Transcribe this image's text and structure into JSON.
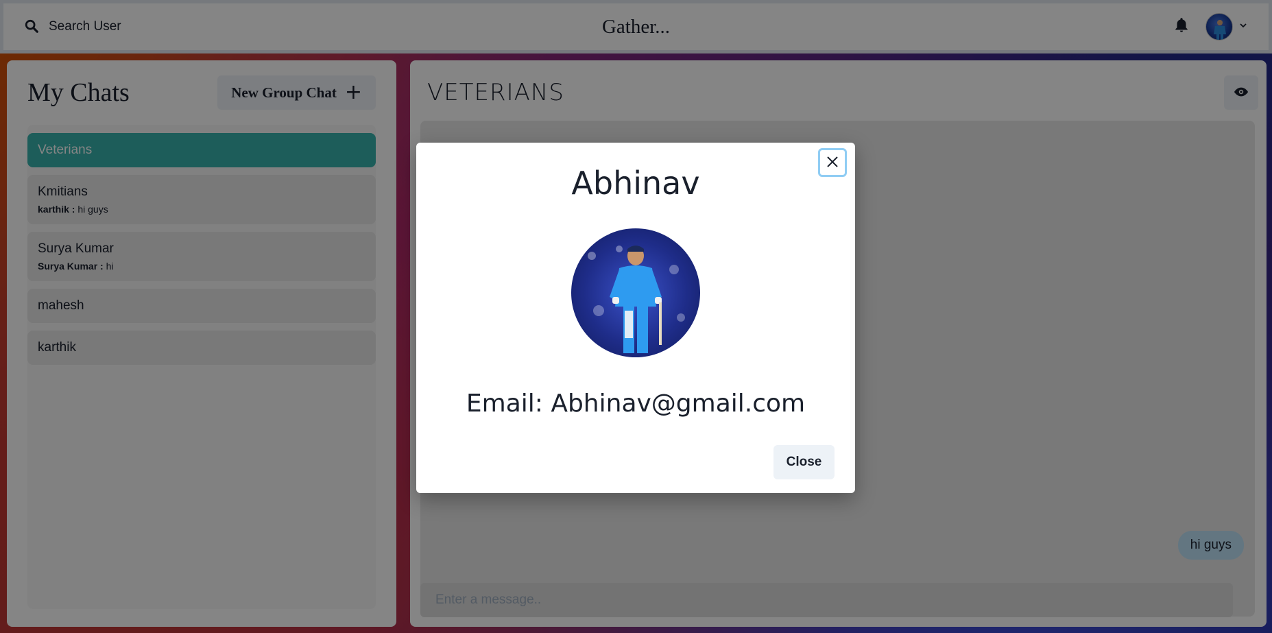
{
  "header": {
    "search_label": "Search User",
    "brand": "Gather..."
  },
  "sidebar": {
    "title": "My Chats",
    "new_group_label": "New Group Chat",
    "chats": [
      {
        "name": "Veterians",
        "latest_sender": "",
        "latest_text": "",
        "active": true
      },
      {
        "name": "Kmitians",
        "latest_sender": "karthik : ",
        "latest_text": "hi guys",
        "active": false
      },
      {
        "name": "Surya Kumar",
        "latest_sender": "Surya Kumar : ",
        "latest_text": "hi",
        "active": false
      },
      {
        "name": "mahesh",
        "latest_sender": "",
        "latest_text": "",
        "active": false
      },
      {
        "name": "karthik",
        "latest_sender": "",
        "latest_text": "",
        "active": false
      }
    ]
  },
  "conversation": {
    "title": "VETERIANS",
    "messages": [
      {
        "text": "hi guys",
        "outgoing": true
      }
    ],
    "input_placeholder": "Enter a message.."
  },
  "modal": {
    "title": "Abhinav",
    "email_text": "Email: Abhinav@gmail.com",
    "close_label": "Close"
  },
  "colors": {
    "accent_teal": "#38b2ac",
    "message_bubble": "#bee3f8",
    "focus_ring": "#90cdf4"
  }
}
